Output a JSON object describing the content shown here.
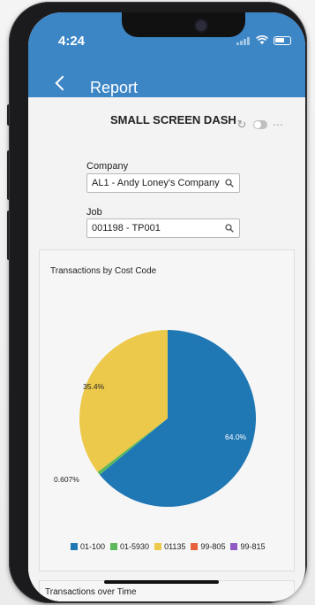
{
  "status": {
    "time": "4:24"
  },
  "header": {
    "title": "Report"
  },
  "dashboard": {
    "title": "SMALL SCREEN DASH",
    "filters": {
      "company": {
        "label": "Company",
        "value": "AL1 - Andy Loney's Company"
      },
      "job": {
        "label": "Job",
        "value": "001198 - TP001"
      }
    }
  },
  "chart_card": {
    "title": "Transactions by Cost Code"
  },
  "chart_data": {
    "type": "pie",
    "title": "Transactions by Cost Code",
    "categories": [
      "01-100",
      "01-5930",
      "01135",
      "99-805",
      "99-815"
    ],
    "values": [
      64.0,
      0.607,
      35.4,
      0,
      0
    ],
    "slice_labels": [
      "64.0%",
      "0.607%",
      "35.4%",
      "",
      ""
    ],
    "colors": [
      "#1f77b4",
      "#5cb85c",
      "#ecc94b",
      "#e8603c",
      "#8e5cc4"
    ],
    "legend_position": "bottom"
  },
  "card2": {
    "title": "Transactions over Time"
  },
  "icons": {
    "back": "chevron-left-icon",
    "refresh": "refresh-icon",
    "toggle": "toggle-icon",
    "more": "more-dots-icon",
    "search": "search-icon"
  }
}
